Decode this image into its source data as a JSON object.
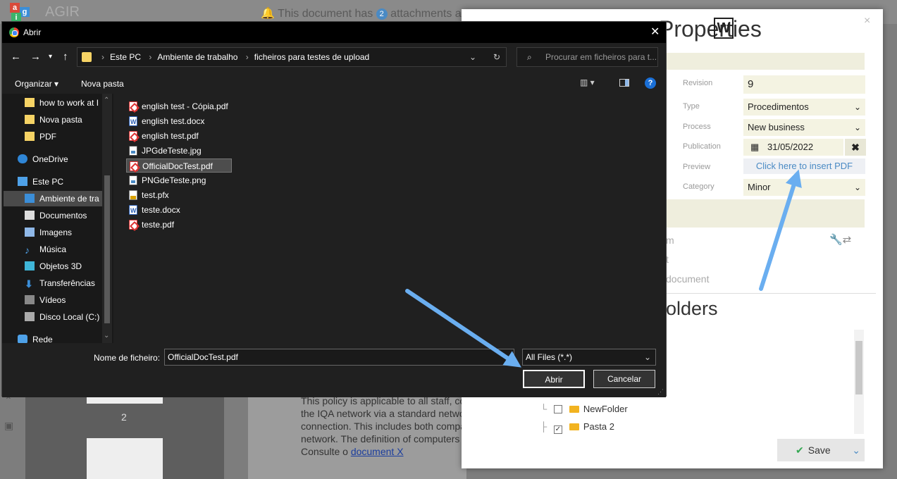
{
  "background_app": {
    "app_title": "AGIR",
    "notice_prefix": "This document has",
    "notice_count": "2",
    "notice_suffix": "attachments a",
    "page_number": "2",
    "doc_lines": [
      "This policy is applicable to all staff, co",
      "the IQA network via a standard network",
      "connection. This includes both compa",
      "network. The definition of computers"
    ],
    "doc_consult": "Consulte o",
    "doc_link": "document X"
  },
  "properties": {
    "title": "Properties",
    "word_badge": "W",
    "close": "×",
    "fields": {
      "revision_label": "Revision",
      "revision_value": "9",
      "type_label": "Type",
      "type_value": "Procedimentos",
      "process_label": "Process",
      "process_value": "New business",
      "publication_label": "Publication",
      "publication_value": "31/05/2022",
      "preview_label": "Preview",
      "preview_link": "Click here to insert PDF",
      "category_label": "Category",
      "category_value": "Minor"
    },
    "ghost_texts": [
      "m",
      "t",
      "document"
    ],
    "folders_title": "olders",
    "tree": [
      {
        "label": "NewFolder",
        "checked": false
      },
      {
        "label": "Pasta 2",
        "checked": true
      }
    ],
    "save_label": "Save"
  },
  "dialog": {
    "title": "Abrir",
    "close": "✕",
    "address_crumbs": [
      "Este PC",
      "Ambiente de trabalho",
      "ficheiros para testes de upload"
    ],
    "search_placeholder": "Procurar em ficheiros para t...",
    "toolbar": {
      "organize": "Organizar",
      "new_folder": "Nova pasta"
    },
    "nav_items": [
      {
        "label": "how to work at I",
        "icon": "folder-icon"
      },
      {
        "label": "Nova pasta",
        "icon": "folder-icon"
      },
      {
        "label": "PDF",
        "icon": "folder-icon"
      },
      {
        "label": "OneDrive",
        "icon": "cloud-icon"
      },
      {
        "label": "Este PC",
        "icon": "computer-icon"
      },
      {
        "label": "Ambiente de tra",
        "icon": "desktop-icon"
      },
      {
        "label": "Documentos",
        "icon": "documents-icon"
      },
      {
        "label": "Imagens",
        "icon": "pictures-icon"
      },
      {
        "label": "Música",
        "icon": "music-icon"
      },
      {
        "label": "Objetos 3D",
        "icon": "cube-icon"
      },
      {
        "label": "Transferências",
        "icon": "download-icon"
      },
      {
        "label": "Vídeos",
        "icon": "video-icon"
      },
      {
        "label": "Disco Local (C:)",
        "icon": "drive-icon"
      },
      {
        "label": "Rede",
        "icon": "network-icon"
      }
    ],
    "files": [
      {
        "name": "english test - Cópia.pdf",
        "type": "pdf"
      },
      {
        "name": "english test.docx",
        "type": "docx"
      },
      {
        "name": "english test.pdf",
        "type": "pdf"
      },
      {
        "name": "JPGdeTeste.jpg",
        "type": "img"
      },
      {
        "name": "OfficialDocTest.pdf",
        "type": "pdf",
        "selected": true
      },
      {
        "name": "PNGdeTeste.png",
        "type": "img"
      },
      {
        "name": "test.pfx",
        "type": "pfx"
      },
      {
        "name": "teste.docx",
        "type": "docx"
      },
      {
        "name": "teste.pdf",
        "type": "pdf"
      }
    ],
    "filename_label": "Nome de ficheiro:",
    "filename_value": "OfficialDocTest.pdf",
    "filetype_value": "All Files (*.*)",
    "open_label": "Abrir",
    "cancel_label": "Cancelar"
  },
  "colors": {
    "dialog_bg": "#202020",
    "annotation_arrow": "#6aaef0",
    "link_blue": "#4a8ac4",
    "beige_field": "#f4f3e2"
  }
}
